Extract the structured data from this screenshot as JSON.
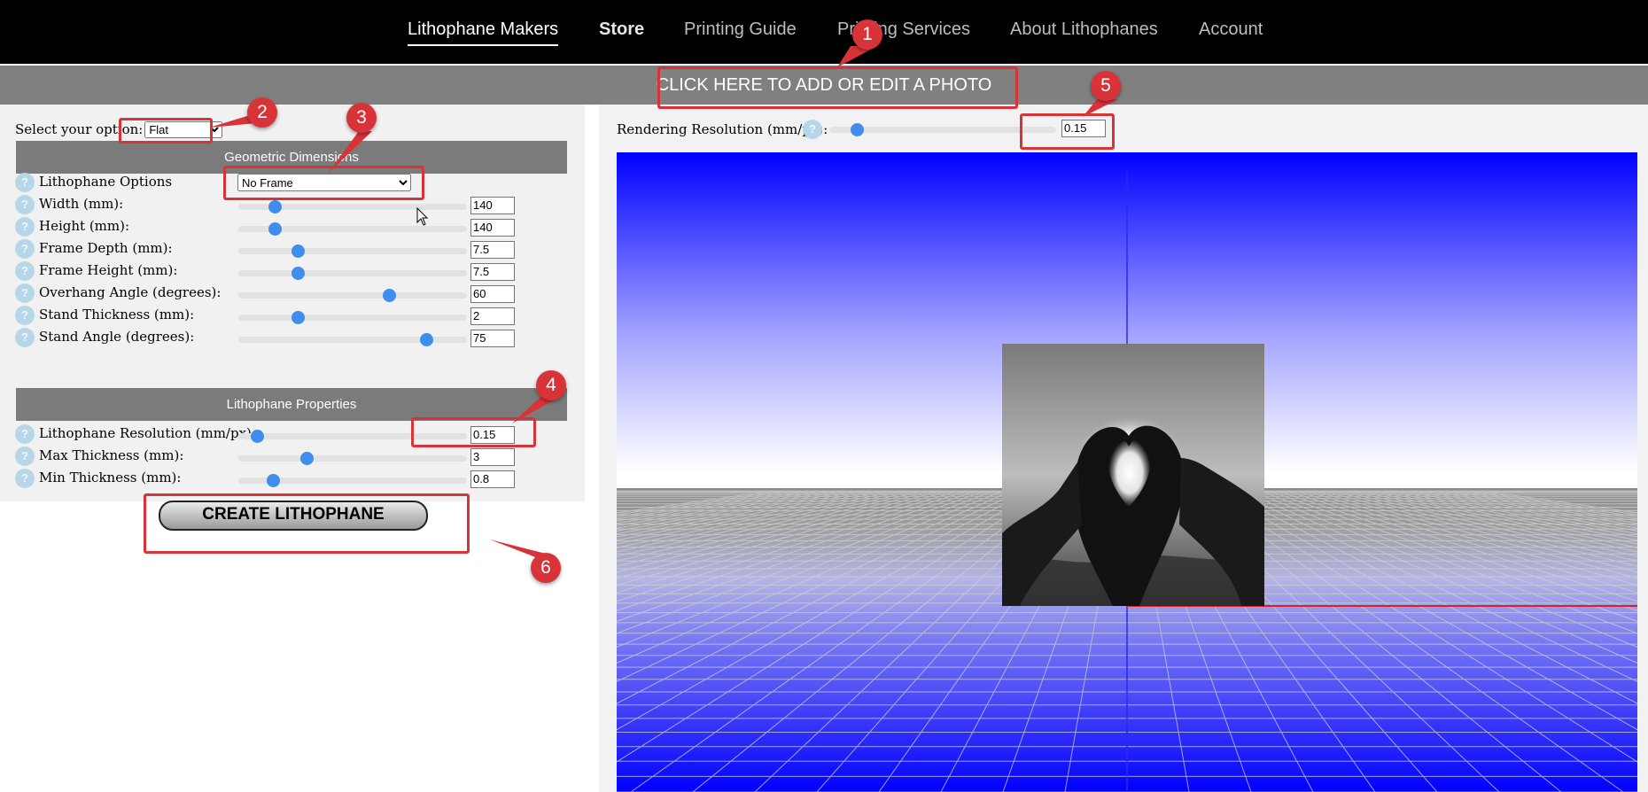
{
  "nav": {
    "items": [
      {
        "label": "Lithophane Makers"
      },
      {
        "label": "Store"
      },
      {
        "label": "Printing Guide"
      },
      {
        "label": "Printing Services"
      },
      {
        "label": "About Lithophanes"
      },
      {
        "label": "Account"
      }
    ]
  },
  "upload": {
    "label": "CLICK HERE TO ADD OR EDIT A PHOTO"
  },
  "left": {
    "select_label": "Select your option:",
    "select_value": "Flat",
    "geometric_header": "Geometric Dimensions",
    "help_glyph": "?",
    "options_label": "Lithophane Options",
    "options_value": "No Frame",
    "geometric_rows": [
      {
        "label": "Width (mm):",
        "value": "140",
        "slider_fraction": 0.16
      },
      {
        "label": "Height (mm):",
        "value": "140",
        "slider_fraction": 0.16
      },
      {
        "label": "Frame Depth (mm):",
        "value": "7.5",
        "slider_fraction": 0.26
      },
      {
        "label": "Frame Height (mm):",
        "value": "7.5",
        "slider_fraction": 0.26
      },
      {
        "label": "Overhang Angle (degrees):",
        "value": "60",
        "slider_fraction": 0.66
      },
      {
        "label": "Stand Thickness (mm):",
        "value": "2",
        "slider_fraction": 0.26
      },
      {
        "label": "Stand Angle (degrees):",
        "value": "75",
        "slider_fraction": 0.82
      }
    ],
    "properties_header": "Lithophane Properties",
    "property_rows": [
      {
        "label": "Lithophane Resolution (mm/px):",
        "value": "0.15",
        "slider_fraction": 0.08
      },
      {
        "label": "Max Thickness (mm):",
        "value": "3",
        "slider_fraction": 0.3
      },
      {
        "label": "Min Thickness (mm):",
        "value": "0.8",
        "slider_fraction": 0.15
      }
    ],
    "create_button": "CREATE LITHOPHANE"
  },
  "render": {
    "label": "Rendering Resolution (mm/px):",
    "value": "0.15",
    "slider_fraction": 0.12
  },
  "viewport": {
    "sky_top": "#0000ff",
    "horizon": "#ffffff",
    "ground": "#8c8c8c",
    "floor_far": "#9a9ae8",
    "floor_near": "#0000ff",
    "grid_color": "#cfcfcf",
    "axis_blue": "#2a2af0",
    "axis_red": "#e02020",
    "photo_subject": "heart-hands-sunset-grayscale"
  },
  "annotations": {
    "color": "#d9333a",
    "markers": [
      "1",
      "2",
      "3",
      "4",
      "5",
      "6"
    ]
  }
}
